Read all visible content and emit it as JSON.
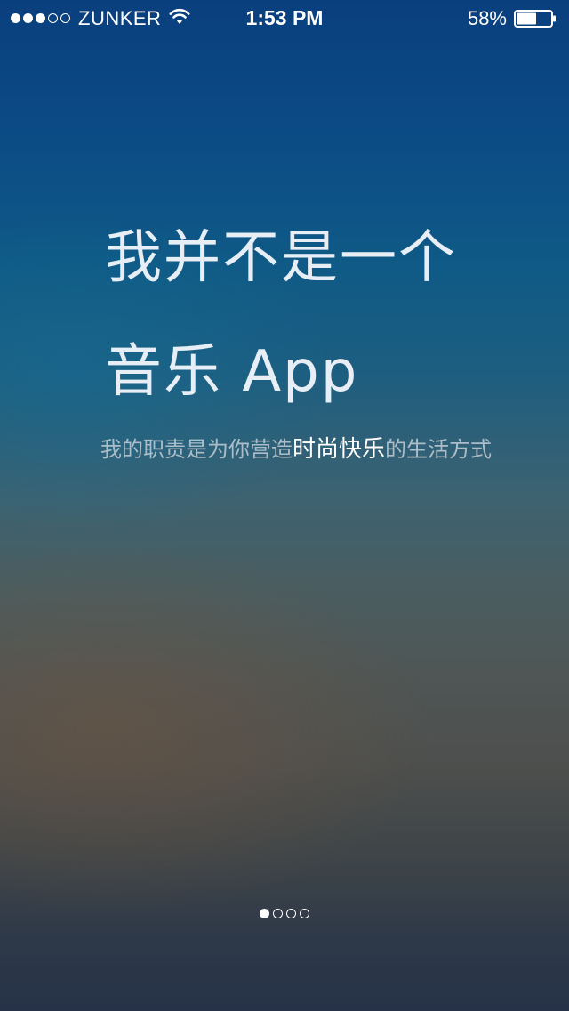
{
  "status_bar": {
    "carrier": "ZUNKER",
    "time": "1:53 PM",
    "battery_percent": "58%",
    "battery_level": 0.58,
    "signal_bars_filled": 3,
    "signal_bars_total": 5,
    "wifi_icon": "wifi-icon",
    "battery_icon": "battery-icon"
  },
  "intro": {
    "headline_line1": "我并不是一个",
    "headline_line2": "音乐 App",
    "subtitle_prefix": "我的职责是为你营造",
    "subtitle_highlight": "时尚快乐",
    "subtitle_suffix": "的生活方式"
  },
  "pager": {
    "current_page": 1,
    "total_pages": 4
  },
  "colors": {
    "background_top": "#0a3f7e",
    "background_bottom": "#263247",
    "text_primary": "#e7eef5",
    "text_highlight": "#ffffff"
  }
}
